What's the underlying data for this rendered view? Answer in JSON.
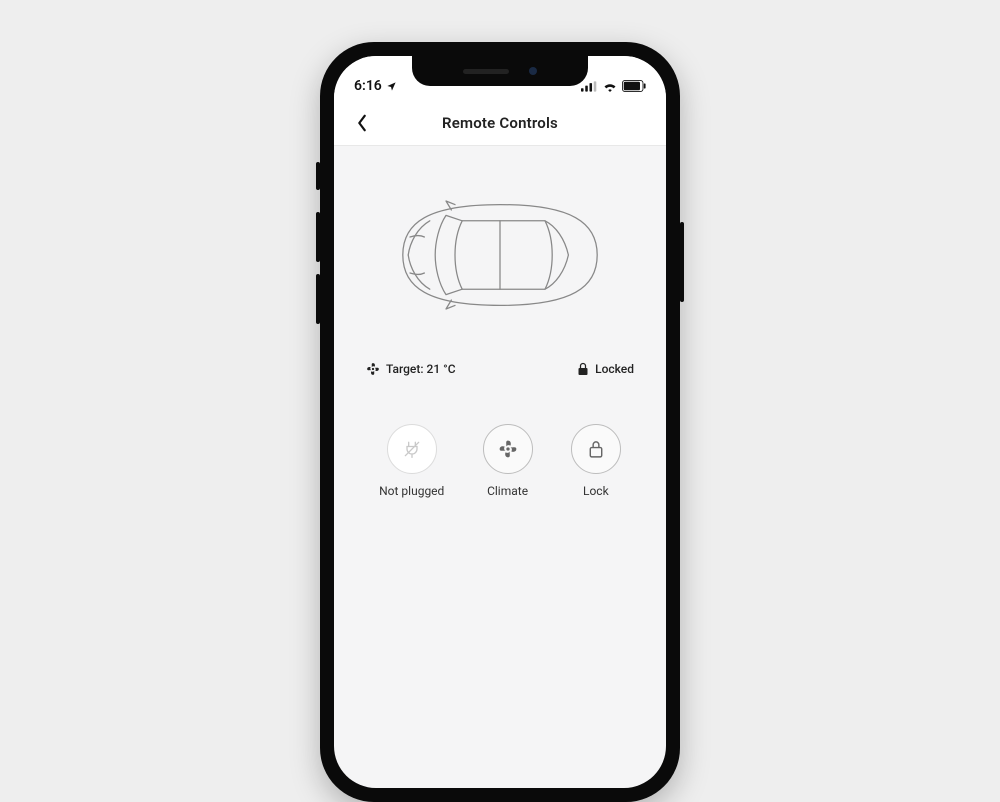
{
  "statusbar": {
    "time": "6:16"
  },
  "header": {
    "title": "Remote Controls"
  },
  "status": {
    "climate_label": "Target: 21 °C",
    "lock_label": "Locked"
  },
  "actions": {
    "plug": {
      "label": "Not plugged"
    },
    "climate": {
      "label": "Climate"
    },
    "lock": {
      "label": "Lock"
    }
  }
}
